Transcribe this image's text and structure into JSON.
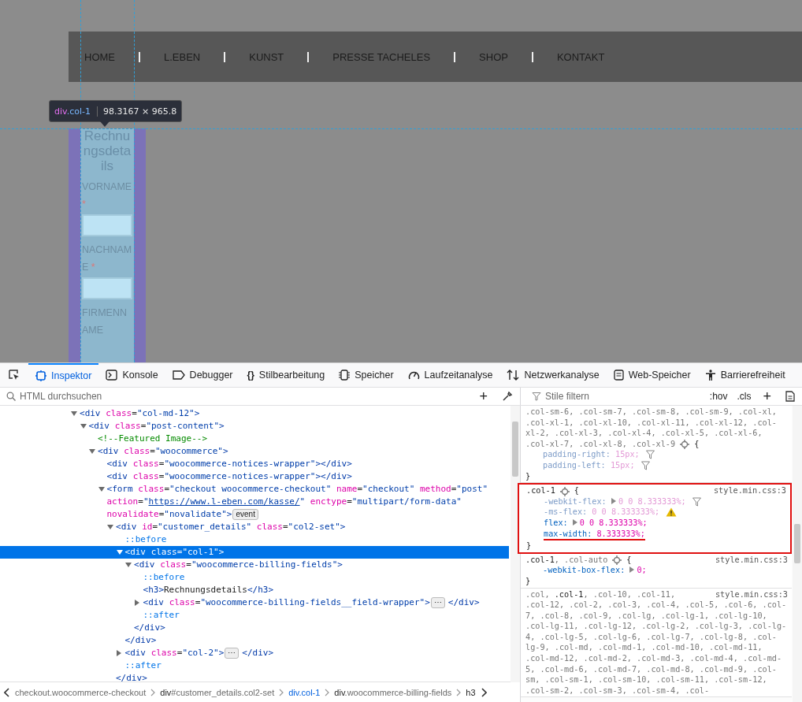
{
  "page": {
    "nav": [
      {
        "label": "HOME"
      },
      {
        "label": "L.EBEN"
      },
      {
        "label": "KUNST"
      },
      {
        "label": "PRESSE TACHELES"
      },
      {
        "label": "SHOP"
      },
      {
        "label": "KONTAKT"
      }
    ],
    "tooltip": {
      "tag": "div",
      "cls": ".col-1",
      "size": "98.3167 × 965.8"
    },
    "column": {
      "heading": "Rechnungsdetails",
      "fields": [
        {
          "label": "VORNAME",
          "mark": "*",
          "kind": "input"
        },
        {
          "label": "NACHNAME",
          "mark": "*",
          "kind": "input"
        },
        {
          "label": "FIRMENNAME",
          "kind": "label"
        }
      ]
    }
  },
  "devtools": {
    "tabs": [
      {
        "label": "Inspektor",
        "kind": "inspector",
        "selected": true
      },
      {
        "label": "Konsole",
        "kind": "console",
        "selected": false
      },
      {
        "label": "Debugger",
        "kind": "debugger",
        "selected": false
      },
      {
        "label": "Stilbearbeitung",
        "kind": "style",
        "glyph": "{}",
        "selected": false
      },
      {
        "label": "Speicher",
        "kind": "memory",
        "selected": false
      },
      {
        "label": "Laufzeitanalyse",
        "kind": "performance",
        "selected": false
      },
      {
        "label": "Netzwerkanalyse",
        "kind": "network",
        "selected": false
      },
      {
        "label": "Web-Speicher",
        "kind": "storage",
        "selected": false
      },
      {
        "label": "Barrierefreiheit",
        "kind": "accessibility",
        "selected": false
      }
    ],
    "html_search": {
      "placeholder": "HTML durchsuchen"
    },
    "add_node": "+",
    "style_filter": {
      "placeholder": "Stile filtern"
    },
    "hov": ":hov",
    "cls": ".cls",
    "add_rule": "+",
    "html_tree": [
      {
        "open": "<div class=\"col-md-12\">",
        "expanded": true,
        "selected": false,
        "children": [
          {
            "open": "<div class=\"post-content\">",
            "expanded": true,
            "selected": false,
            "children": [
              {
                "text": "<!--Featured Image-->",
                "selected": false
              },
              {
                "open": "<div class=\"woocommerce\">",
                "expanded": true,
                "selected": false,
                "children": [
                  {
                    "text": "<div class=\"woocommerce-notices-wrapper\"></div>",
                    "selected": false
                  },
                  {
                    "text": "<div class=\"woocommerce-notices-wrapper\"></div>",
                    "selected": false
                  },
                  {
                    "open": "<form class=\"checkout woocommerce-checkout\" name=\"checkout\" method=\"post\" action=\"https://www.l-eben.com/kasse/\" enctype=\"multipart/form-data\" novalidate=\"novalidate\">",
                    "badge": "event",
                    "expanded": true,
                    "selected": false,
                    "children": [
                      {
                        "open": "<div id=\"customer_details\" class=\"col2-set\">",
                        "expanded": true,
                        "selected": false,
                        "close": "</div>",
                        "children": [
                          {
                            "text": "::before",
                            "selected": false
                          },
                          {
                            "open": "<div class=\"col-1\">",
                            "expanded": true,
                            "selected": true,
                            "close": "</div>",
                            "children": [
                              {
                                "open": "<div class=\"woocommerce-billing-fields\">",
                                "expanded": true,
                                "selected": false,
                                "close": "</div>",
                                "children": [
                                  {
                                    "text": "::before",
                                    "selected": false
                                  },
                                  {
                                    "text": "<h3>Rechnungsdetails</h3>",
                                    "selected": false
                                  },
                                  {
                                    "open": "<div class=\"woocommerce-billing-fields__field-wrapper\">",
                                    "badge": "⋯",
                                    "close": "</div>",
                                    "expanded": false,
                                    "selected": false
                                  },
                                  {
                                    "text": "::after",
                                    "selected": false
                                  }
                                ]
                              }
                            ]
                          },
                          {
                            "open": "<div class=\"col-2\">",
                            "badge": "⋯",
                            "close": "</div>",
                            "expanded": false,
                            "selected": false
                          },
                          {
                            "text": "::after",
                            "selected": false
                          }
                        ]
                      }
                    ]
                  }
                ]
              }
            ]
          }
        ]
      }
    ],
    "breadcrumbs": [
      {
        "rest": "checkout.woocommerce-checkout",
        "selected": false
      },
      {
        "tag": "div",
        "rest": "#customer_details.col2-set",
        "selected": false
      },
      {
        "tag": "div",
        "rest": ".col-1",
        "selected": true
      },
      {
        "tag": "div",
        "rest": ".woocommerce-billing-fields",
        "selected": false
      },
      {
        "tag": "h3",
        "selected": false
      }
    ],
    "rules": [
      {
        "selector": [
          [
            {
              "text": ".col-sm-6, .col-sm-7, .col-sm-8, .col-sm-9, .col-xl, .col-xl-1, .col-xl-10, .col-xl-11, .col-xl-12, .col-xl-2, .col-xl-3, .col-xl-4, .col-xl-5, .col-xl-6,",
              "matched": false
            }
          ],
          [
            {
              "text": ".col-xl-7, .col-xl-8, .col-xl-9",
              "matched": false
            }
          ]
        ],
        "open": "{",
        "close": "}",
        "highlighted": false,
        "declarations": [
          {
            "property": "padding-right:",
            "value": "15px;",
            "overridden": true,
            "filter": true
          },
          {
            "property": "padding-left:",
            "value": "15px;",
            "overridden": true,
            "filter": true
          }
        ]
      },
      {
        "selector": [
          [
            {
              "text": ".col-1",
              "matched": true
            }
          ]
        ],
        "source": "style.min.css:3",
        "open": "{",
        "close": "}",
        "highlighted": true,
        "declarations": [
          {
            "property": "-webkit-flex:",
            "value": "0 0 8.333333%;",
            "overridden": true,
            "expandable": true,
            "filter": true
          },
          {
            "property": "-ms-flex:",
            "value": "0 0 8.333333%;",
            "overridden": true,
            "warning": true
          },
          {
            "property": "flex:",
            "value": "0 0 8.333333%;",
            "overridden": false,
            "expandable": true
          },
          {
            "property": "max-width:",
            "value": "8.333333%;",
            "overridden": false,
            "underlined": true
          }
        ]
      },
      {
        "selector": [
          [
            {
              "text": ".col-1",
              "matched": true
            },
            {
              "text": ", .col-auto",
              "matched": false
            }
          ]
        ],
        "source": "style.min.css:3",
        "open": "{",
        "close": "}",
        "highlighted": false,
        "declarations": [
          {
            "property": "-webkit-box-flex:",
            "value": "0;",
            "overridden": false,
            "expandable": true
          }
        ]
      },
      {
        "selector": [
          [
            {
              "text": ".col,",
              "matched": false
            },
            {
              "text": ".col-1",
              "matched": true
            },
            {
              "text": ", .col-10, .col-11,",
              "matched": false
            }
          ],
          [
            {
              "text": ".col-12, .col-2, .col-3, .col-4, .col-5, .col-6, .col-7, .col-8, .col-9, .col-lg, .col-lg-1, .col-lg-10, .col-lg-11, .col-lg-12, .col-lg-2, .col-lg-3, .col-lg-4, .col-lg-5, .col-lg-6, .col-lg-7, .col-lg-8, .col-lg-9, .col-md, .col-md-1, .col-md-10, .col-md-11, .col-md-12, .col-md-2, .col-md-3, .col-md-4, .col-md-5, .col-md-6, .col-md-7, .col-md-8, .col-md-9, .col-sm, .col-sm-1, .col-sm-10, .col-sm-11, .col-sm-12, .col-sm-2, .col-sm-3, .col-sm-4, .col-",
              "matched": false
            }
          ]
        ],
        "source": "style.min.css:3",
        "highlighted": false
      }
    ]
  }
}
